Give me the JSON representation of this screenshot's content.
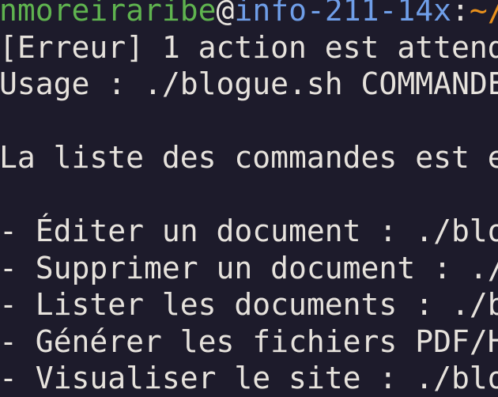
{
  "prompt": {
    "user": "nmoreiraribe",
    "at": "@",
    "host": "info-211-14x",
    "colon": ":",
    "path": "~/"
  },
  "lines": [
    "[Erreur] 1 action est attend",
    "Usage : ./blogue.sh COMMANDE",
    "",
    "La liste des commandes est e",
    "",
    "- Éditer un document : ./blo",
    "- Supprimer un document : ./",
    "- Lister les documents : ./b",
    "- Générer les fichiers PDF/H",
    "- Visualiser le site : ./blo"
  ],
  "colors": {
    "background": "#1d1b2b",
    "user": "#5fb34f",
    "host": "#6f9ee8",
    "path": "#e8901c",
    "text": "#e6e2dc"
  }
}
